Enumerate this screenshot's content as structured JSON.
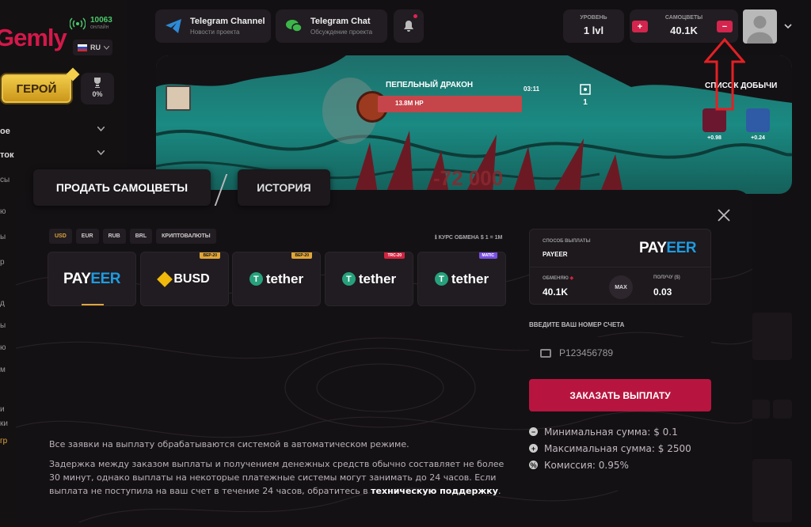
{
  "sidebar": {
    "logo": "Gemly",
    "online_count": "10063",
    "online_label": "онлайн",
    "language": "RU",
    "hero_button": "ГЕРОЙ",
    "hero_percent": "0%",
    "menu": [
      {
        "label": "ое"
      },
      {
        "label": "ток"
      }
    ],
    "stubs": [
      "сы",
      "ю",
      "ы",
      "р",
      "д",
      "ы",
      "ю",
      "м",
      "и",
      "ки",
      "гр"
    ]
  },
  "topbar": {
    "telegram_channel": {
      "title": "Telegram Channel",
      "subtitle": "Новости проекта"
    },
    "telegram_chat": {
      "title": "Telegram Chat",
      "subtitle": "Обсуждение проекта"
    },
    "level": {
      "label": "УРОВЕНЬ",
      "value": "1 lvl"
    },
    "gems": {
      "label": "САМОЦВЕТЫ",
      "value": "40.1K"
    },
    "plus": "+",
    "minus": "−"
  },
  "banner": {
    "boss_name": "ПЕПЕЛЬНЫЙ ДРАКОН",
    "timer": "03:11",
    "hp": "13.8M HP",
    "hp_fraction": 1.0,
    "targets": "1",
    "loot_title": "СПИСОК ДОБЫЧИ",
    "loot": [
      {
        "value": "+0.98"
      },
      {
        "value": "+0.24"
      }
    ],
    "damage": "-72 000"
  },
  "tabs": {
    "sell": "ПРОДАТЬ САМОЦВЕТЫ",
    "history": "ИСТОРИЯ"
  },
  "modal": {
    "currencies": [
      "USD",
      "EUR",
      "RUB",
      "BRL",
      "КРИПТОВАЛЮТЫ"
    ],
    "rate": "КУРС ОБМЕНА $ 1 = 1M",
    "methods": [
      {
        "name": "PAYEER",
        "tag": ""
      },
      {
        "name": "BUSD",
        "tag": "BEP-20"
      },
      {
        "name": "tether",
        "tag": "BEP-20"
      },
      {
        "name": "tether",
        "tag": "TRC-20"
      },
      {
        "name": "tether",
        "tag": "MATIC"
      }
    ],
    "info1": "Все заявки на выплату обрабатываются системой в автоматическом режиме.",
    "info2_pre": "Задержка между заказом выплаты и получением денежных средств обычно составляет не более 30 минут, однако выплаты на некоторые платежные системы могут занимать до 24 часов. Если выплата не поступила на ваш счет в течение 24 часов, обратитесь в ",
    "info2_link": "техническую поддержку",
    "info2_post": ".",
    "panel": {
      "method_label": "СПОСОБ ВЫПЛАТЫ",
      "method_value": "PAYEER",
      "method_logo": "PAYEER",
      "exchange_label": "ОБМЕНЯЮ",
      "exchange_value": "40.1K",
      "max": "MAX",
      "receive_label": "ПОЛУЧУ ($)",
      "receive_value": "0.03"
    },
    "account_label": "ВВЕДИТЕ ВАШ НОМЕР СЧЕТА",
    "account_placeholder": "P123456789",
    "order_button": "ЗАКАЗАТЬ ВЫПЛАТУ",
    "limits": [
      "Минимальная сумма: $ 0.1",
      "Максимальная сумма: $ 2500",
      "Комиссия: 0.95%"
    ]
  },
  "colors": {
    "accent": "#b7153f",
    "gold": "#e0a63a",
    "payeer_blue": "#1f9be0",
    "tether_green": "#26a17b"
  }
}
